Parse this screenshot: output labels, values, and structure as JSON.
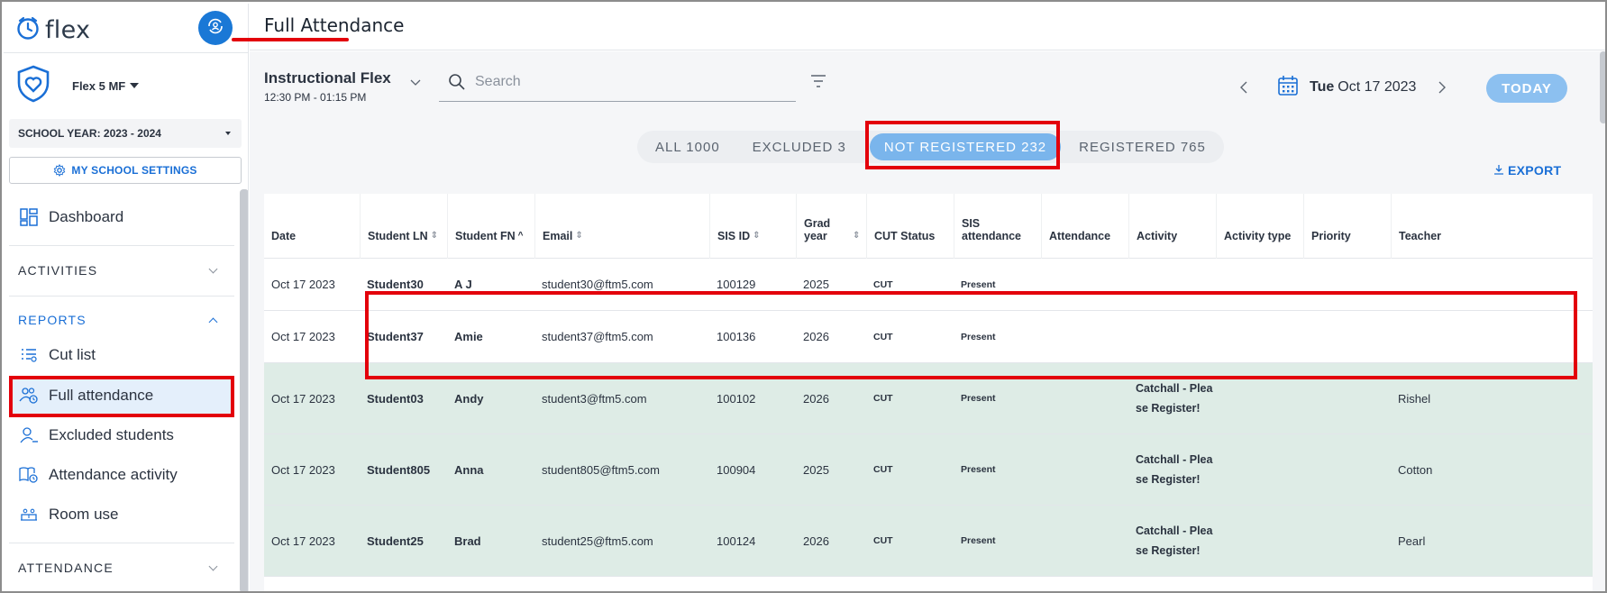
{
  "app": {
    "logo_text": "flex"
  },
  "sidebar": {
    "school": "Flex 5 MF",
    "school_year": "SCHOOL YEAR: 2023 - 2024",
    "settings_label": "MY SCHOOL SETTINGS",
    "dashboard_label": "Dashboard",
    "sections": {
      "activities": "ACTIVITIES",
      "reports": "REPORTS",
      "attendance": "ATTENDANCE"
    },
    "reports_items": [
      "Cut list",
      "Full attendance",
      "Excluded students",
      "Attendance activity",
      "Room use"
    ]
  },
  "header": {
    "title": "Full Attendance"
  },
  "toolbar": {
    "period_name": "Instructional Flex",
    "period_time": "12:30 PM - 01:15 PM",
    "search_placeholder": "Search",
    "date_day": "Tue",
    "date_rest": "Oct 17 2023",
    "today_label": "TODAY",
    "export_label": "EXPORT"
  },
  "tabs": [
    {
      "label": "ALL 1000"
    },
    {
      "label": "EXCLUDED 3"
    },
    {
      "label": "NOT REGISTERED 232"
    },
    {
      "label": "REGISTERED 765"
    }
  ],
  "table": {
    "headers": [
      "Date",
      "Student LN",
      "Student FN",
      "Email",
      "SIS ID",
      "Grad year",
      "CUT Status",
      "SIS attendance",
      "Attendance",
      "Activity",
      "Activity type",
      "Priority",
      "Teacher"
    ],
    "rows": [
      {
        "date": "Oct 17 2023",
        "ln": "Student30",
        "fn": "A J",
        "email": "student30@ftm5.com",
        "sis": "100129",
        "grad": "2025",
        "cut": "CUT",
        "sisatt": "Present",
        "att": "",
        "activity1": "",
        "activity2": "",
        "type": "",
        "priority": "",
        "teacher": ""
      },
      {
        "date": "Oct 17 2023",
        "ln": "Student37",
        "fn": "Amie",
        "email": "student37@ftm5.com",
        "sis": "100136",
        "grad": "2026",
        "cut": "CUT",
        "sisatt": "Present",
        "att": "",
        "activity1": "",
        "activity2": "",
        "type": "",
        "priority": "",
        "teacher": ""
      },
      {
        "date": "Oct 17 2023",
        "ln": "Student03",
        "fn": "Andy",
        "email": "student3@ftm5.com",
        "sis": "100102",
        "grad": "2026",
        "cut": "CUT",
        "sisatt": "Present",
        "att": "",
        "activity1": "Catchall - Plea",
        "activity2": "se Register!",
        "type": "",
        "priority": "",
        "teacher": "Rishel"
      },
      {
        "date": "Oct 17 2023",
        "ln": "Student805",
        "fn": "Anna",
        "email": "student805@ftm5.com",
        "sis": "100904",
        "grad": "2025",
        "cut": "CUT",
        "sisatt": "Present",
        "att": "",
        "activity1": "Catchall - Plea",
        "activity2": "se Register!",
        "type": "",
        "priority": "",
        "teacher": "Cotton"
      },
      {
        "date": "Oct 17 2023",
        "ln": "Student25",
        "fn": "Brad",
        "email": "student25@ftm5.com",
        "sis": "100124",
        "grad": "2026",
        "cut": "CUT",
        "sisatt": "Present",
        "att": "",
        "activity1": "Catchall - Plea",
        "activity2": "se Register!",
        "type": "",
        "priority": "",
        "teacher": "Pearl"
      }
    ]
  },
  "colors": {
    "accent": "#1a6fd6",
    "highlight": "#e3000b",
    "registered_row": "#deece6",
    "tab_active": "#7ab5ec"
  }
}
